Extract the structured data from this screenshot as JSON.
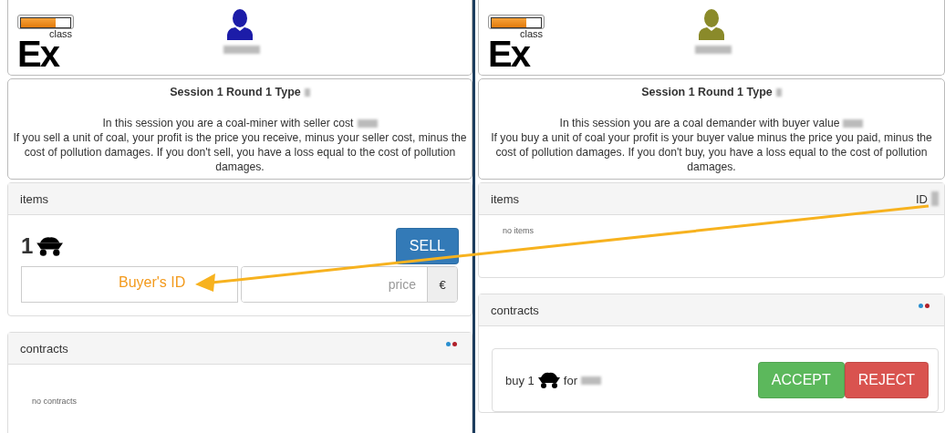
{
  "panes": [
    {
      "logo": {
        "big": "Ex",
        "small": "class",
        "level": 0.7
      },
      "user": {
        "color": "#1c1ca8"
      },
      "session": {
        "title": "Session 1 Round 1 Type",
        "intro": "In this session you are a coal-miner with seller cost",
        "body": "If you sell a unit of coal, your profit is the price you receive, minus your seller cost, minus the cost of pollution damages. If you don't sell, you have a loss equal to the cost of pollution damages."
      },
      "items": {
        "title": "items",
        "kind": "offer",
        "count": "1",
        "button": "SELL",
        "price_placeholder": "price",
        "currency": "€"
      },
      "contracts": {
        "title": "contracts",
        "dots": [
          {
            "color": "#2a8fd0"
          },
          {
            "color": "#b0202a"
          }
        ],
        "kind": "empty",
        "empty_text": "no contracts"
      }
    },
    {
      "logo": {
        "big": "Ex",
        "small": "class",
        "level": 0.7
      },
      "user": {
        "color": "#8a8a2a"
      },
      "session": {
        "title": "Session 1 Round 1 Type",
        "intro": "In this session you are a coal demander with buyer value",
        "body": "If you buy a unit of coal your profit is your buyer value minus the price you paid, minus the cost of pollution damages. If you don't buy, you have a loss equal to the cost of pollution damages."
      },
      "items": {
        "title": "items",
        "id_label": "ID",
        "kind": "empty",
        "empty_text": "no items"
      },
      "contracts": {
        "title": "contracts",
        "dots": [
          {
            "color": "#2a8fd0"
          },
          {
            "color": "#b0202a"
          }
        ],
        "kind": "list",
        "rows": [
          {
            "prefix": "buy 1",
            "middle": "for",
            "accept": "ACCEPT",
            "reject": "REJECT"
          }
        ]
      }
    }
  ],
  "annotation": {
    "label": "Buyer's ID"
  }
}
